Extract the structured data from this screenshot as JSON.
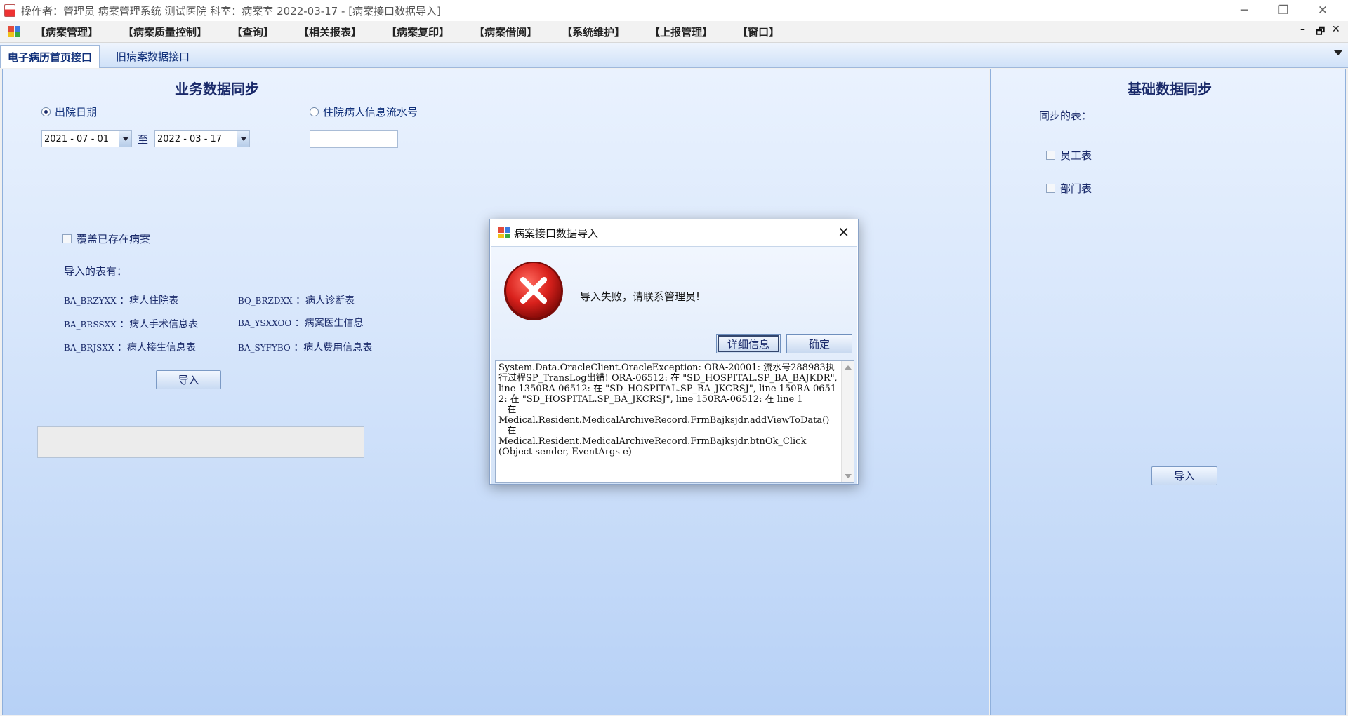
{
  "window": {
    "title": "操作者：管理员  病案管理系统  测试医院  科室：病案室  2022-03-17 - [病案接口数据导入]"
  },
  "menu": {
    "items": [
      "【病案管理】",
      "【病案质量控制】",
      "【查询】",
      "【相关报表】",
      "【病案复印】",
      "【病案借阅】",
      "【系统维护】",
      "【上报管理】",
      "【窗口】"
    ],
    "mdi_minimize": "–",
    "mdi_restore": "🗗",
    "mdi_close": "✕"
  },
  "tabs": {
    "active": "电子病历首页接口",
    "inactive": "旧病案数据接口"
  },
  "business": {
    "title": "业务数据同步",
    "radio_discharge": "出院日期",
    "radio_serial": "住院病人信息流水号",
    "date_from": "2021 - 07 - 01",
    "date_to": "2022 - 03 - 17",
    "to": "至",
    "overwrite": "覆盖已存在病案",
    "tables_label": "导入的表有：",
    "tables": [
      {
        "code": "BA_BRZYXX",
        "name": "：病人住院表"
      },
      {
        "code": "BQ_BRZDXX",
        "name": "：病人诊断表"
      },
      {
        "code": "BA_BRSSXX",
        "name": "：病人手术信息表"
      },
      {
        "code": "BA_YSXXOO",
        "name": "：病案医生信息"
      },
      {
        "code": "BA_BRJSXX",
        "name": "：病人接生信息表"
      },
      {
        "code": "BA_SYFYBO",
        "name": "：病人费用信息表"
      }
    ],
    "import_button": "导入"
  },
  "base": {
    "title": "基础数据同步",
    "sync_label": "同步的表：",
    "staff": "员工表",
    "dept": "部门表",
    "import_button": "导入"
  },
  "dialog": {
    "title": "病案接口数据导入",
    "message": "导入失败，请联系管理员!",
    "details_button": "详细信息",
    "ok_button": "确定",
    "detail_text": "System.Data.OracleClient.OracleException: ORA-20001: 流水号288983执行过程SP_TransLog出错! ORA-06512: 在 \"SD_HOSPITAL.SP_BA_BAJKDR\", line 1350RA-06512: 在 \"SD_HOSPITAL.SP_BA_JKCRSJ\", line 150RA-06512: 在 \"SD_HOSPITAL.SP_BA_JKCRSJ\", line 150RA-06512: 在 line 1\n   在\nMedical.Resident.MedicalArchiveRecord.FrmBajksjdr.addViewToData()\n   在\nMedical.Resident.MedicalArchiveRecord.FrmBajksjdr.btnOk_Click\n(Object sender, EventArgs e)"
  },
  "colors": {
    "accent": "#1a2a6a",
    "error_red": "#d9211c",
    "panel_top": "#eaf2fe",
    "panel_bottom": "#b7d1f6"
  }
}
